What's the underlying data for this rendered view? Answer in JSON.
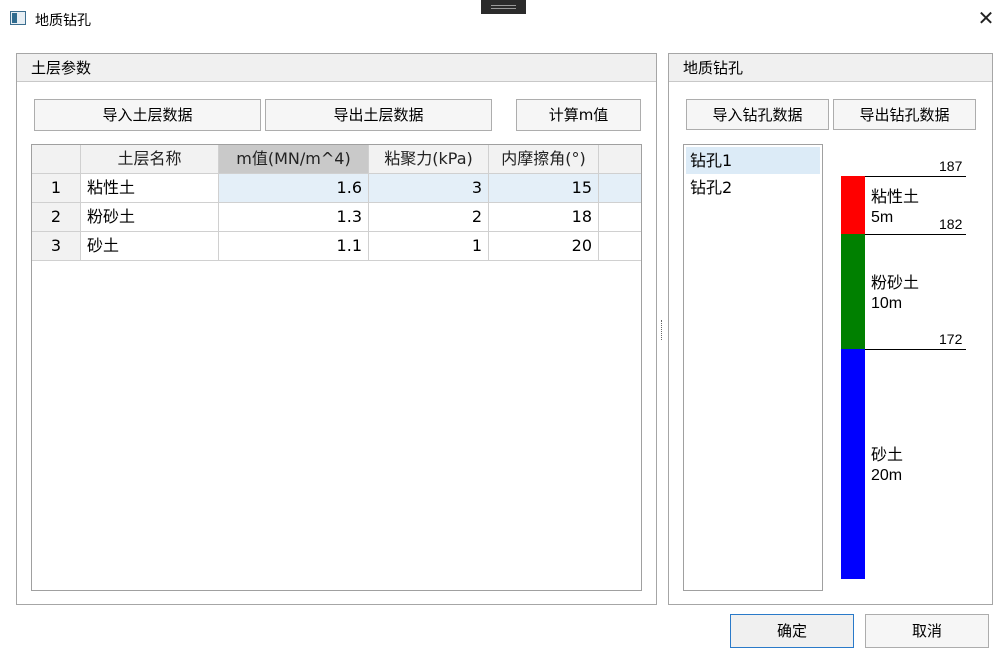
{
  "window": {
    "title": "地质钻孔",
    "close_glyph": "✕"
  },
  "soil_panel": {
    "title": "土层参数",
    "buttons": {
      "import": "导入土层数据",
      "export": "导出土层数据",
      "calc": "计算m值"
    },
    "columns": [
      "土层名称",
      "m值(MN/m^4)",
      "粘聚力(kPa)",
      "内摩擦角(°)"
    ],
    "rows": [
      {
        "index": "1",
        "name": "粘性土",
        "m": "1.6",
        "cohesion": "3",
        "friction": "15"
      },
      {
        "index": "2",
        "name": "粉砂土",
        "m": "1.3",
        "cohesion": "2",
        "friction": "18"
      },
      {
        "index": "3",
        "name": "砂土",
        "m": "1.1",
        "cohesion": "1",
        "friction": "20"
      }
    ]
  },
  "bore_panel": {
    "title": "地质钻孔",
    "buttons": {
      "import": "导入钻孔数据",
      "export": "导出钻孔数据"
    },
    "boreholes": [
      "钻孔1",
      "钻孔2"
    ],
    "selected_borehole": "钻孔1",
    "column": {
      "top_elevation": "187",
      "layers": [
        {
          "name": "粘性土",
          "thickness": "5m",
          "bottom_elevation": "182",
          "color": "#ff0000"
        },
        {
          "name": "粉砂土",
          "thickness": "10m",
          "bottom_elevation": "172",
          "color": "#008000"
        },
        {
          "name": "砂土",
          "thickness": "20m",
          "color": "#0000ff"
        }
      ]
    }
  },
  "footer": {
    "ok": "确定",
    "cancel": "取消"
  }
}
